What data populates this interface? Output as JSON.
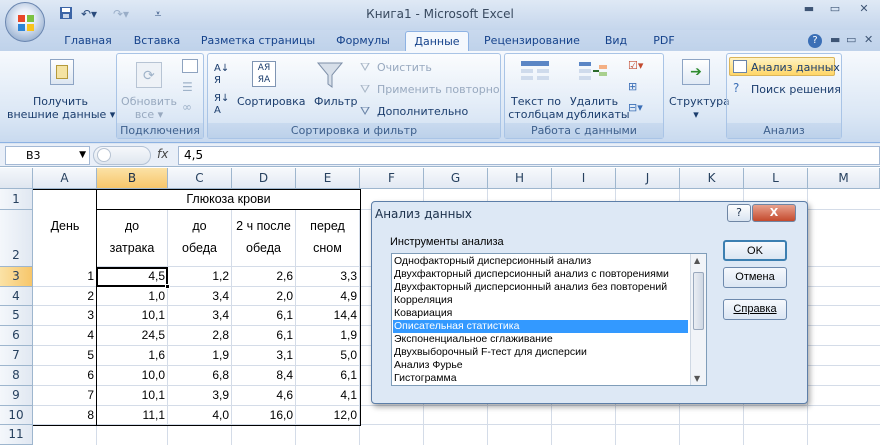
{
  "window": {
    "title": "Книга1 - Microsoft Excel"
  },
  "tabs": [
    "Главная",
    "Вставка",
    "Разметка страницы",
    "Формулы",
    "Данные",
    "Рецензирование",
    "Вид",
    "PDF"
  ],
  "ribbon": {
    "get_external": "Получить",
    "get_external_2": "внешние данные",
    "refresh_all": "Обновить",
    "refresh_all_2": "все",
    "connections_group": "Подключения",
    "sort": "Сортировка",
    "filter": "Фильтр",
    "clear": "Очистить",
    "reapply": "Применить повторно",
    "advanced": "Дополнительно",
    "sort_filter_group": "Сортировка и фильтр",
    "text_to_columns": "Текст по",
    "text_to_columns_2": "столбцам",
    "remove_duplicates": "Удалить",
    "remove_duplicates_2": "дубликаты",
    "data_tools_group": "Работа с данными",
    "outline": "Структура",
    "data_analysis": "Анализ данных",
    "solver": "Поиск решения",
    "analysis_group": "Анализ",
    "sort_icon_top": "АЯ",
    "sort_icon_bot": "ЯА"
  },
  "formula_bar": {
    "name_box": "B3",
    "fx": "fx",
    "content": "4,5"
  },
  "sheet": {
    "columns": [
      "A",
      "B",
      "C",
      "D",
      "E",
      "F",
      "G",
      "H",
      "I",
      "J",
      "K",
      "L",
      "M"
    ],
    "rows": [
      "1",
      "2",
      "3",
      "4",
      "5",
      "6",
      "7",
      "8",
      "9",
      "10",
      "11"
    ],
    "header_day": "День",
    "header_glucose": "Глюкоза крови",
    "sub_headers": [
      [
        "до",
        "затрака"
      ],
      [
        "до",
        "обеда"
      ],
      [
        "2 ч после",
        "обеда"
      ],
      [
        "перед",
        "сном"
      ]
    ],
    "data": [
      [
        "1",
        "4,5",
        "1,2",
        "2,6",
        "3,3"
      ],
      [
        "2",
        "1,0",
        "3,4",
        "2,0",
        "4,9"
      ],
      [
        "3",
        "10,1",
        "3,4",
        "6,1",
        "14,4"
      ],
      [
        "4",
        "24,5",
        "2,8",
        "6,1",
        "1,9"
      ],
      [
        "5",
        "1,6",
        "1,9",
        "3,1",
        "5,0"
      ],
      [
        "6",
        "10,0",
        "6,8",
        "8,4",
        "6,1"
      ],
      [
        "7",
        "10,1",
        "3,9",
        "4,6",
        "4,1"
      ],
      [
        "8",
        "11,1",
        "4,0",
        "16,0",
        "12,0"
      ]
    ]
  },
  "dialog": {
    "title": "Анализ данных",
    "help_glyph": "?",
    "close_glyph": "X",
    "list_label": "Инструменты анализа",
    "items": [
      "Однофакторный дисперсионный анализ",
      "Двухфакторный дисперсионный анализ с повторениями",
      "Двухфакторный дисперсионный анализ без повторений",
      "Корреляция",
      "Ковариация",
      "Описательная статистика",
      "Экспоненциальное сглаживание",
      "Двухвыборочный F-тест для дисперсии",
      "Анализ Фурье",
      "Гистограмма"
    ],
    "selected_index": 5,
    "ok": "OK",
    "cancel": "Отмена",
    "help": "Справка"
  },
  "colors": {
    "accent": "#f7c66a",
    "selection": "#3399ff",
    "ribbon_text": "#15428b"
  }
}
